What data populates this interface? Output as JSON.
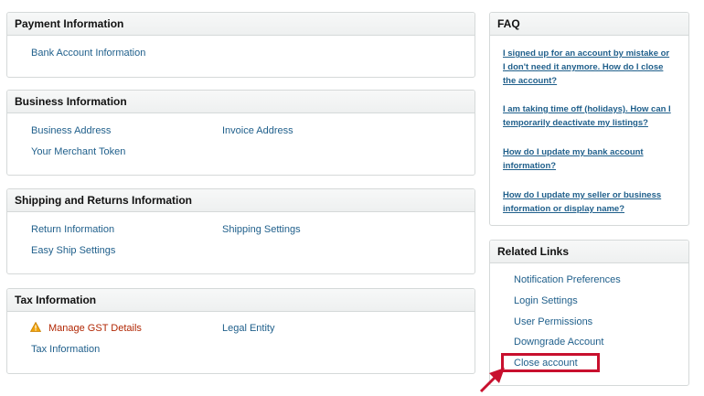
{
  "payment": {
    "title": "Payment Information",
    "links": [
      "Bank Account Information"
    ]
  },
  "business": {
    "title": "Business Information",
    "links": [
      "Business Address",
      "Invoice Address",
      "Your Merchant Token"
    ]
  },
  "shipping": {
    "title": "Shipping and Returns Information",
    "links": [
      "Return Information",
      "Shipping Settings",
      "Easy Ship Settings"
    ]
  },
  "tax": {
    "title": "Tax Information",
    "links": [
      "Manage GST Details",
      "Legal Entity",
      "Tax Information"
    ]
  },
  "faq": {
    "title": "FAQ",
    "items": [
      "I signed up for an account by mistake or I don't need it anymore. How do I close the account?",
      "I am taking time off (holidays). How can I temporarily deactivate my listings?",
      "How do I update my bank account information?",
      "How do I update my seller or business information or display name?"
    ]
  },
  "related": {
    "title": "Related Links",
    "links": [
      "Notification Preferences",
      "Login Settings",
      "User Permissions",
      "Downgrade Account",
      "Close account"
    ]
  },
  "icons": {
    "warning": "warning-triangle-icon",
    "annotation": "red-arrow-annotation"
  },
  "colors": {
    "link": "#1f5f8b",
    "warning_link": "#b12704",
    "highlight": "#c8102e",
    "warning_icon": "#f0a30a"
  }
}
